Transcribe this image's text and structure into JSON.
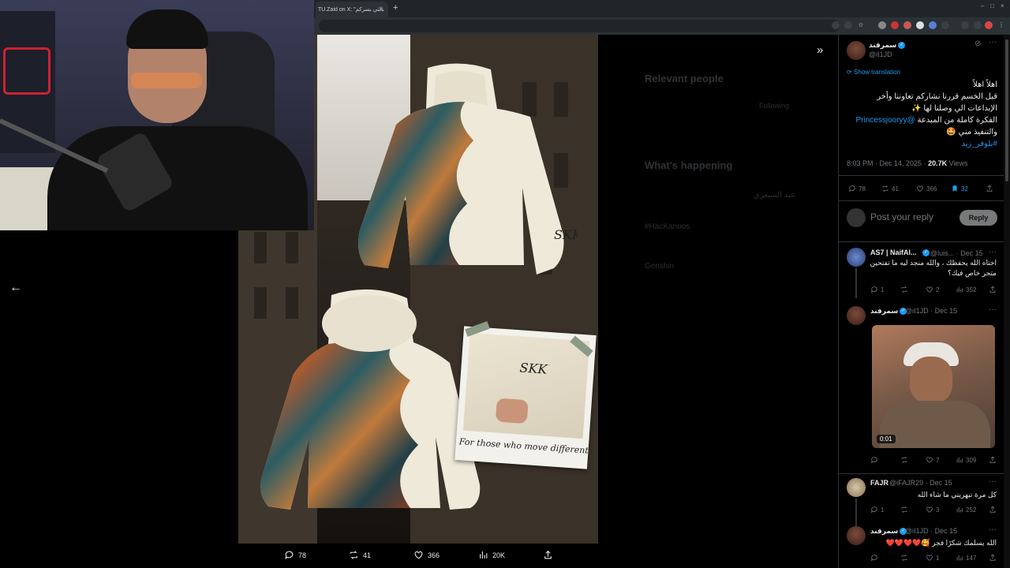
{
  "browser": {
    "tab_title": "TU.Zaid on X: \"بالثي بسركم",
    "new_tab": "+",
    "close_tab": "×",
    "window_controls": [
      "–",
      "□",
      "×"
    ]
  },
  "viewer": {
    "hoodie_logo": "SKK",
    "polaroid_caption": "For those who move different",
    "actions": {
      "replies": "78",
      "reposts": "41",
      "likes": "366",
      "views": "20K"
    }
  },
  "background_page": {
    "relevant_people": "Relevant people",
    "following": "Following",
    "whats_happening": "What's happening",
    "trend_1": "#HacKanoos",
    "trend_2": "Genshin",
    "trend_3": "عيد السبعري"
  },
  "tweet": {
    "author_name": "سمرقند",
    "author_handle": "@iI1JD",
    "show_translation": "Show translation",
    "lines": [
      "اهلاً اهلاً",
      "قبل الخسم قررنا نشاركم تعاوننا وأخر",
      "الإبداعات الي وصلنا لها ✨",
      "الفكرة كاملة من المبدعة @Princessjooryy",
      "والتنفيذ مني 🤩",
      "#بلوفر_زيد"
    ],
    "mention": "@Princessjooryy",
    "hashtag": "#بلوفر_زيد",
    "timestamp": "8:03 PM · Dec 14, 2025 · ",
    "views_count": "20.7K",
    "views_label": " Views",
    "stats": {
      "replies": "78",
      "reposts": "41",
      "likes": "366",
      "bookmarks": "32"
    }
  },
  "reply_box": {
    "placeholder": "Post your reply",
    "button": "Reply"
  },
  "replies": [
    {
      "name": "AS7 | NaifAl...",
      "handle": "@luis...",
      "date": "· Dec 15",
      "text": "اختاه الله يحفظك ، والله منجد ليه ما تفتحين متجر خاص فيك؟",
      "reply_count": "1",
      "likes": "2",
      "views": "352"
    },
    {
      "name": "سمرقند",
      "handle": "@iI1JD",
      "date": "· Dec 15",
      "video_time": "0:01",
      "likes": "7",
      "views": "309"
    },
    {
      "name": "FAJR",
      "handle": "@iFAJR29",
      "date": "· Dec 15",
      "text": "كل مرة تبهريني ما شاء الله",
      "reply_count": "1",
      "likes": "3",
      "views": "252"
    },
    {
      "name": "سمرقند",
      "handle": "@iI1JD",
      "date": "· Dec 15",
      "text": "الله يسلمك شكرًا فجر 🥰❤️❤️❤️❤️",
      "likes": "1",
      "views": "147"
    }
  ]
}
